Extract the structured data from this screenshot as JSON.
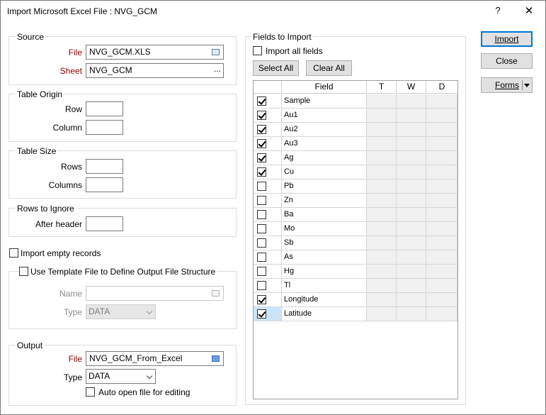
{
  "window": {
    "title": "Import Microsoft Excel File : NVG_GCM",
    "help": "?",
    "close": "✕"
  },
  "source": {
    "legend": "Source",
    "file_label": "File",
    "file_value": "NVG_GCM.XLS",
    "sheet_label": "Sheet",
    "sheet_value": "NVG_GCM",
    "sheet_browse": "..."
  },
  "table_origin": {
    "legend": "Table Origin",
    "row_label": "Row",
    "column_label": "Column",
    "row_value": "",
    "column_value": ""
  },
  "table_size": {
    "legend": "Table Size",
    "rows_label": "Rows",
    "columns_label": "Columns",
    "rows_value": "",
    "columns_value": ""
  },
  "rows_to_ignore": {
    "legend": "Rows to Ignore",
    "after_header_label": "After header",
    "after_header_value": ""
  },
  "import_empty_records": {
    "label": "Import empty records",
    "checked": false
  },
  "template": {
    "label": "Use Template File to Define Output File Structure",
    "checked": false,
    "name_label": "Name",
    "name_value": "",
    "type_label": "Type",
    "type_value": "DATA"
  },
  "output": {
    "legend": "Output",
    "file_label": "File",
    "file_value": "NVG_GCM_From_Excel",
    "type_label": "Type",
    "type_value": "DATA",
    "auto_open_label": "Auto open file for editing",
    "auto_open_checked": false
  },
  "fields": {
    "legend": "Fields to Import",
    "import_all_label": "Import all fields",
    "import_all_checked": false,
    "select_all": "Select All",
    "clear_all": "Clear All",
    "columns": [
      "Field",
      "T",
      "W",
      "D"
    ],
    "rows": [
      {
        "name": "Sample",
        "checked": true
      },
      {
        "name": "Au1",
        "checked": true
      },
      {
        "name": "Au2",
        "checked": true
      },
      {
        "name": "Au3",
        "checked": true
      },
      {
        "name": "Ag",
        "checked": true
      },
      {
        "name": "Cu",
        "checked": true
      },
      {
        "name": "Pb",
        "checked": false
      },
      {
        "name": "Zn",
        "checked": false
      },
      {
        "name": "Ba",
        "checked": false
      },
      {
        "name": "Mo",
        "checked": false
      },
      {
        "name": "Sb",
        "checked": false
      },
      {
        "name": "As",
        "checked": false
      },
      {
        "name": "Hg",
        "checked": false
      },
      {
        "name": "Tl",
        "checked": false
      },
      {
        "name": "Longitude",
        "checked": true
      },
      {
        "name": "Latitude",
        "checked": true
      }
    ]
  },
  "buttons": {
    "import": "Import",
    "close": "Close",
    "forms": "Forms"
  },
  "colors": {
    "accent": "#0078d7",
    "required_label": "#8b0000",
    "selection": "#cce4f7"
  }
}
